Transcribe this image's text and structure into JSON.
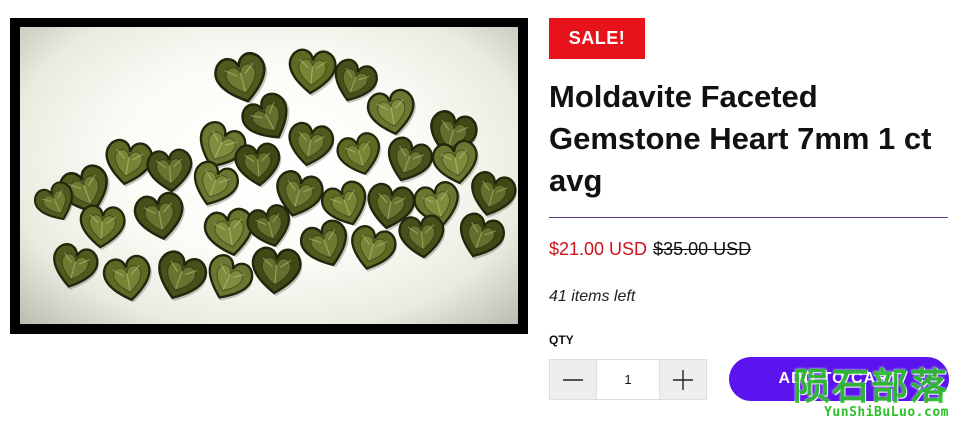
{
  "product": {
    "badge": "SALE!",
    "title": "Moldavite Faceted Gemstone Heart 7mm 1 ct avg",
    "price_sale": "$21.00 USD",
    "price_original": "$35.00 USD",
    "stock_text": "41 items left",
    "image_icon": "moldavite-hearts-photo"
  },
  "purchase": {
    "qty_label": "QTY",
    "qty_value": "1",
    "decrement_icon": "minus-icon",
    "increment_icon": "plus-icon",
    "add_to_cart_label": "ADD TO CART"
  },
  "watermark": {
    "main": "陨石部落",
    "sub": "YunShiBuLuo.com"
  },
  "colors": {
    "sale_badge": "#e8121b",
    "sale_price": "#d0121b",
    "button": "#5b14ee",
    "divider": "#5b3c8a",
    "watermark": "#2ec02a"
  }
}
